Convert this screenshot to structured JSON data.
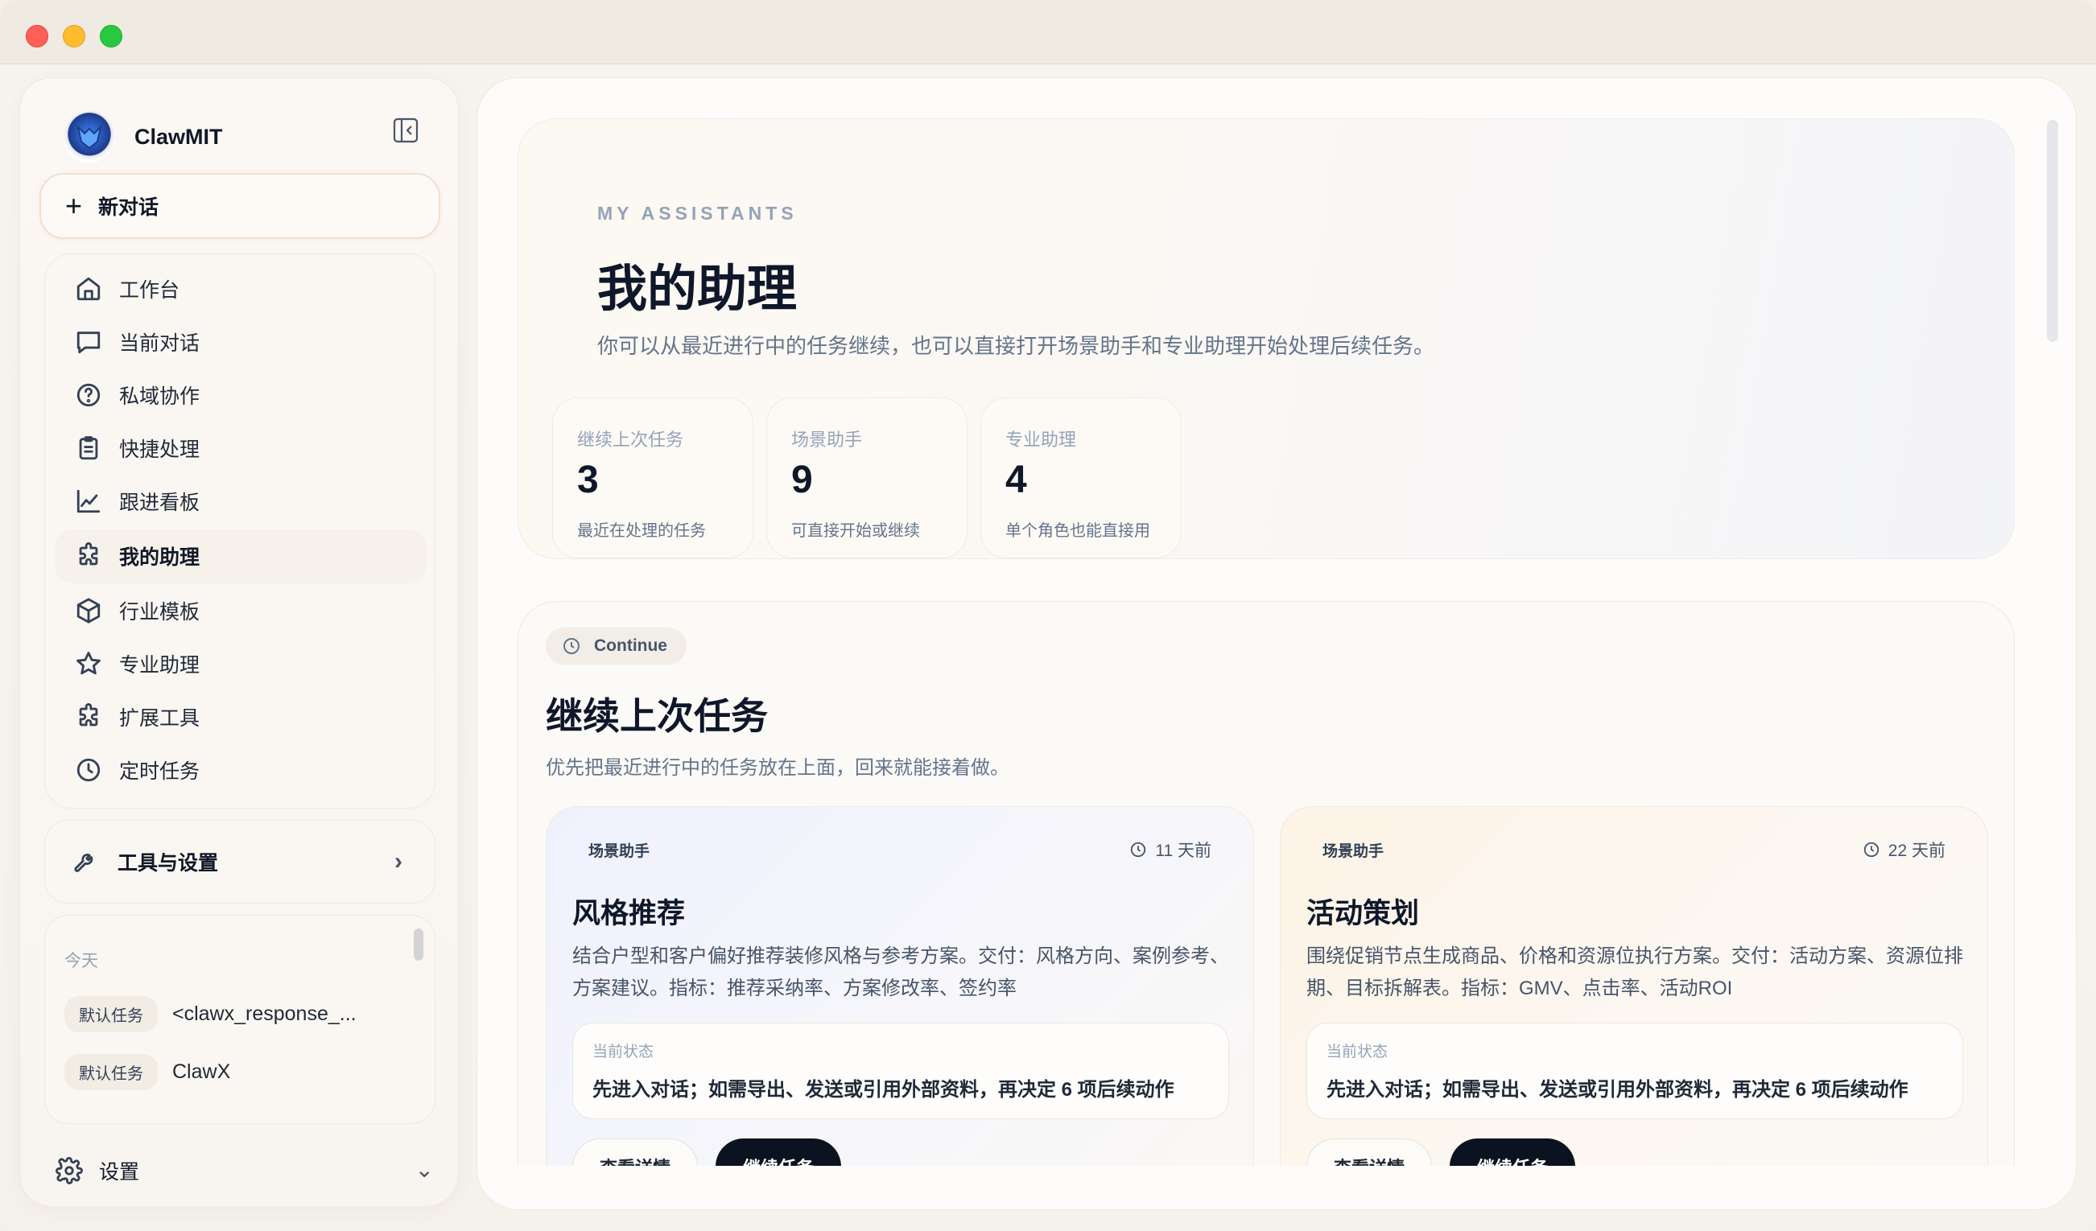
{
  "app": {
    "name": "ClawMIT"
  },
  "sidebar": {
    "new_chat": "新对话",
    "nav": [
      {
        "label": "工作台",
        "icon": "home-icon"
      },
      {
        "label": "当前对话",
        "icon": "chat-icon"
      },
      {
        "label": "私域协作",
        "icon": "question-icon"
      },
      {
        "label": "快捷处理",
        "icon": "clipboard-icon"
      },
      {
        "label": "跟进看板",
        "icon": "chart-line-icon"
      },
      {
        "label": "我的助理",
        "icon": "puzzle-icon",
        "active": true
      },
      {
        "label": "行业模板",
        "icon": "cube-icon"
      },
      {
        "label": "专业助理",
        "icon": "star-icon"
      },
      {
        "label": "扩展工具",
        "icon": "puzzle-icon"
      },
      {
        "label": "定时任务",
        "icon": "clock-icon"
      }
    ],
    "tools_settings": "工具与设置",
    "history": {
      "group": "今天",
      "items": [
        {
          "tag": "默认任务",
          "title": "<clawx_response_..."
        },
        {
          "tag": "默认任务",
          "title": "ClawX"
        }
      ]
    },
    "settings": "设置"
  },
  "hero": {
    "eyebrow": "MY ASSISTANTS",
    "title": "我的助理",
    "description": "你可以从最近进行中的任务继续，也可以直接打开场景助手和专业助理开始处理后续任务。",
    "stats": [
      {
        "label": "继续上次任务",
        "value": "3",
        "sub": "最近在处理的任务"
      },
      {
        "label": "场景助手",
        "value": "9",
        "sub": "可直接开始或继续"
      },
      {
        "label": "专业助理",
        "value": "4",
        "sub": "单个角色也能直接用"
      }
    ]
  },
  "continue": {
    "pill": "Continue",
    "title": "继续上次任务",
    "description": "优先把最近进行中的任务放在上面，回来就能接着做。",
    "cards": [
      {
        "tag": "场景助手",
        "time": "11 天前",
        "title": "风格推荐",
        "description": "结合户型和客户偏好推荐装修风格与参考方案。交付：风格方向、案例参考、方案建议。指标：推荐采纳率、方案修改率、签约率",
        "status_label": "当前状态",
        "status": "先进入对话；如需导出、发送或引用外部资料，再决定 6 项后续动作",
        "btn_detail": "查看详情",
        "btn_continue": "继续任务"
      },
      {
        "tag": "场景助手",
        "time": "22 天前",
        "title": "活动策划",
        "description": "围绕促销节点生成商品、价格和资源位执行方案。交付：活动方案、资源位排期、目标拆解表。指标：GMV、点击率、活动ROI",
        "status_label": "当前状态",
        "status": "先进入对话；如需导出、发送或引用外部资料，再决定 6 项后续动作",
        "btn_detail": "查看详情",
        "btn_continue": "继续任务"
      }
    ]
  }
}
